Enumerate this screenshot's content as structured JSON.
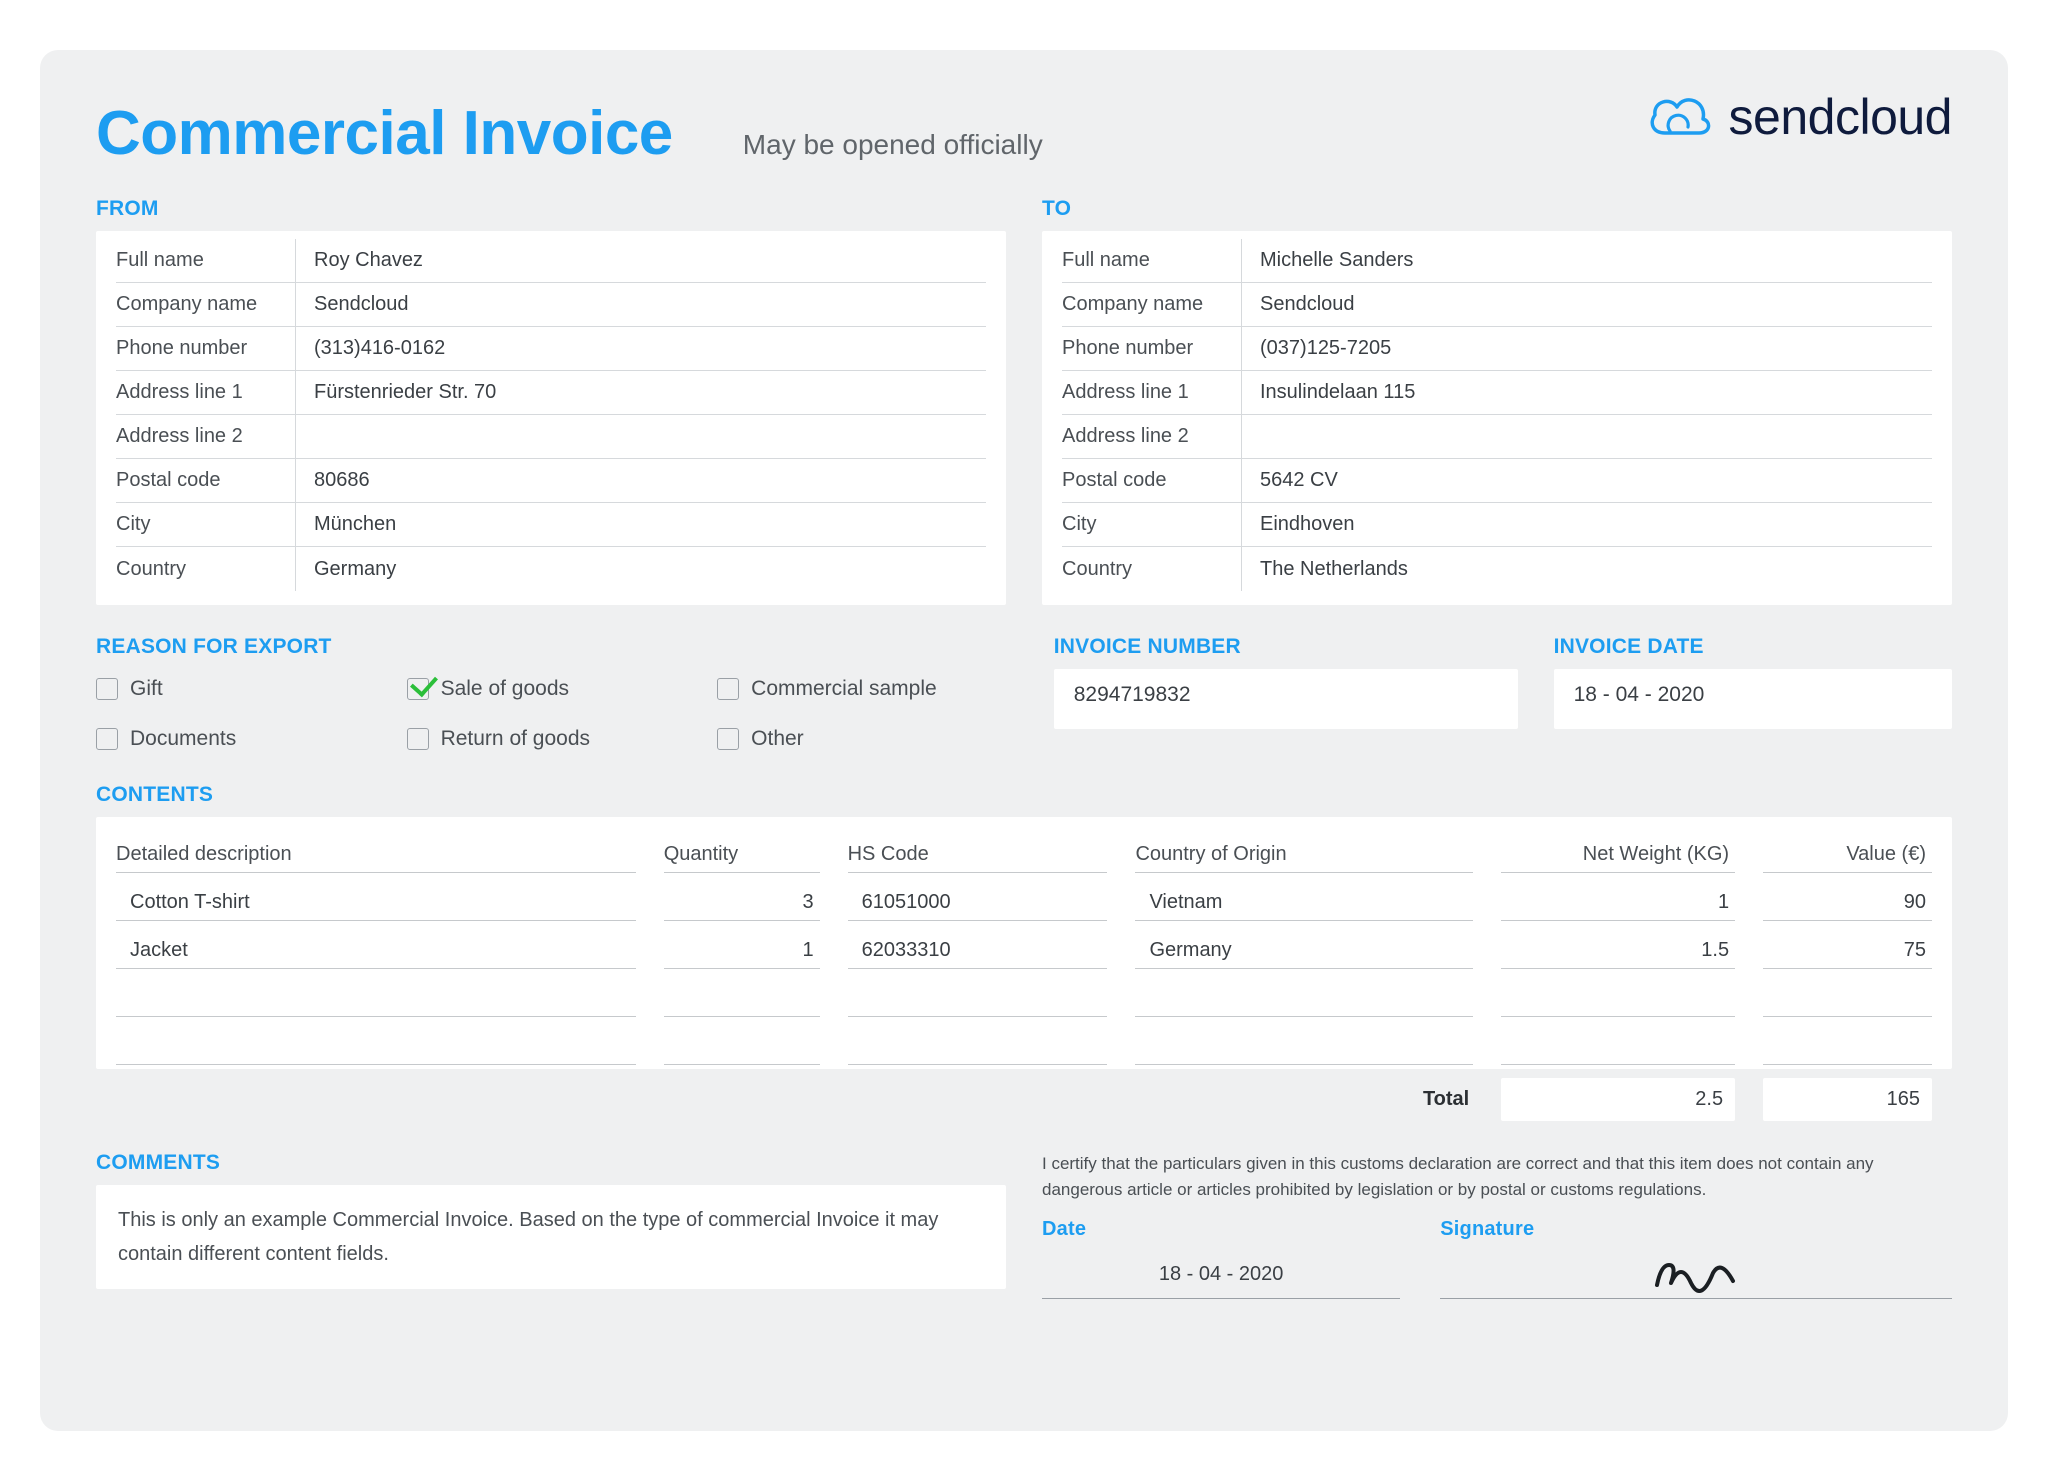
{
  "header": {
    "title": "Commercial Invoice",
    "subtitle": "May be opened officially",
    "brand": "sendcloud"
  },
  "labels": {
    "from": "FROM",
    "to": "TO",
    "full_name": "Full name",
    "company_name": "Company name",
    "phone_number": "Phone number",
    "address1": "Address line 1",
    "address2": "Address line 2",
    "postal_code": "Postal code",
    "city": "City",
    "country": "Country",
    "reason_export": "REASON FOR EXPORT",
    "invoice_number": "INVOICE NUMBER",
    "invoice_date": "INVOICE DATE",
    "contents": "CONTENTS",
    "comments": "COMMENTS",
    "date": "Date",
    "signature": "Signature",
    "total": "Total"
  },
  "from": {
    "full_name": "Roy Chavez",
    "company_name": "Sendcloud",
    "phone_number": "(313)416-0162",
    "address1": "Fürstenrieder Str. 70",
    "address2": "",
    "postal_code": "80686",
    "city": "München",
    "country": "Germany"
  },
  "to": {
    "full_name": "Michelle Sanders",
    "company_name": "Sendcloud",
    "phone_number": "(037)125-7205",
    "address1": "Insulindelaan 115",
    "address2": "",
    "postal_code": "5642 CV",
    "city": "Eindhoven",
    "country": "The Netherlands"
  },
  "export_reasons": {
    "gift": "Gift",
    "sale_of_goods": "Sale of goods",
    "commercial_sample": "Commercial sample",
    "documents": "Documents",
    "return_of_goods": "Return of goods",
    "other": "Other",
    "selected": "sale_of_goods"
  },
  "invoice": {
    "number": "8294719832",
    "date": "18 - 04 - 2020"
  },
  "contents": {
    "headers": {
      "desc": "Detailed description",
      "qty": "Quantity",
      "hs": "HS Code",
      "origin": "Country of Origin",
      "netw": "Net Weight (KG)",
      "value": "Value (€)"
    },
    "rows": [
      {
        "desc": "Cotton T-shirt",
        "qty": "3",
        "hs": "61051000",
        "origin": "Vietnam",
        "netw": "1",
        "value": "90"
      },
      {
        "desc": "Jacket",
        "qty": "1",
        "hs": "62033310",
        "origin": "Germany",
        "netw": "1.5",
        "value": "75"
      }
    ],
    "total": {
      "netw": "2.5",
      "value": "165"
    }
  },
  "comments": "This is only an example Commercial Invoice. Based on the type of commercial Invoice it may contain different content fields.",
  "certification": "I certify that the particulars given in this customs declaration are correct and that this item does not contain any dangerous article or articles prohibited by legislation or by postal or customs regulations.",
  "sign_date": "18 - 04 - 2020"
}
